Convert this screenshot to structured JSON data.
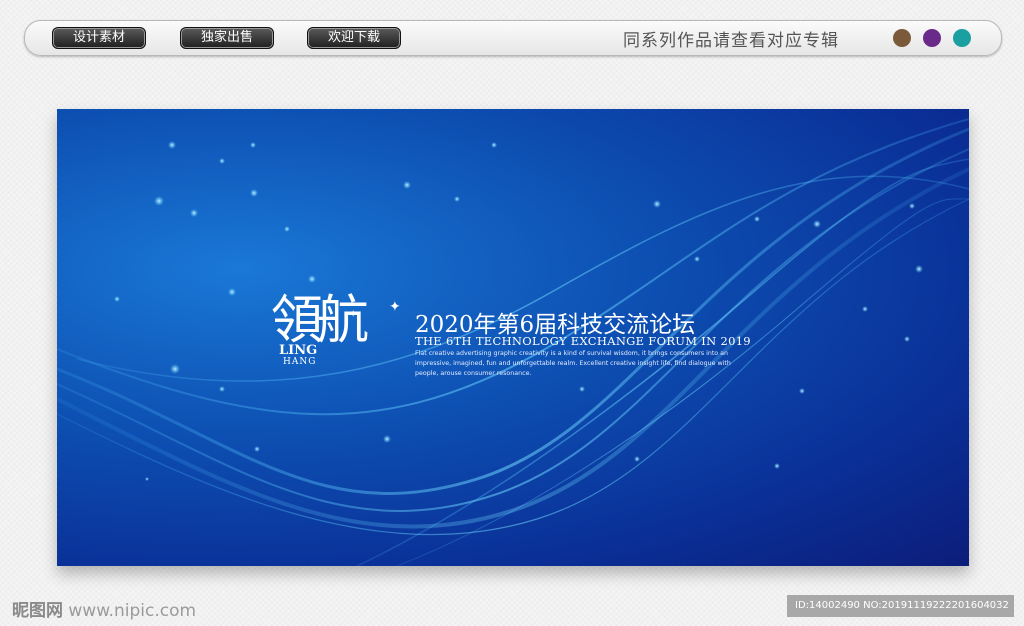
{
  "toolbar": {
    "buttons": [
      "设计素材",
      "独家出售",
      "欢迎下载"
    ],
    "series_text": "同系列作品请查看对应专辑",
    "color_dots": [
      "#7a5a3a",
      "#6a2a8a",
      "#1aa0a0"
    ]
  },
  "banner": {
    "logo_cn": "領航",
    "logo_line1": "LING",
    "logo_line2": "HANG",
    "title_cn": "2020年第6届科技交流论坛",
    "title_en": "THE 6TH TECHNOLOGY EXCHANGE FORUM IN 2019",
    "description": "Flat creative advertising graphic creativity is a kind of survival wisdom, it brings consumers into an impressive, imagined, fun and unforgettable realm. Excellent creative insight life, find dialogue with people, arouse consumer resonance.",
    "colors": {
      "deep": "#0c1d7a",
      "mid": "#0d4fb2",
      "light": "#1a78d6",
      "glow": "#5fd0ff"
    }
  },
  "footer": {
    "watermark_brand": "昵图网",
    "watermark_url": "www.nipic.com",
    "id_text": "ID:14002490 NO:20191119222201604032"
  }
}
